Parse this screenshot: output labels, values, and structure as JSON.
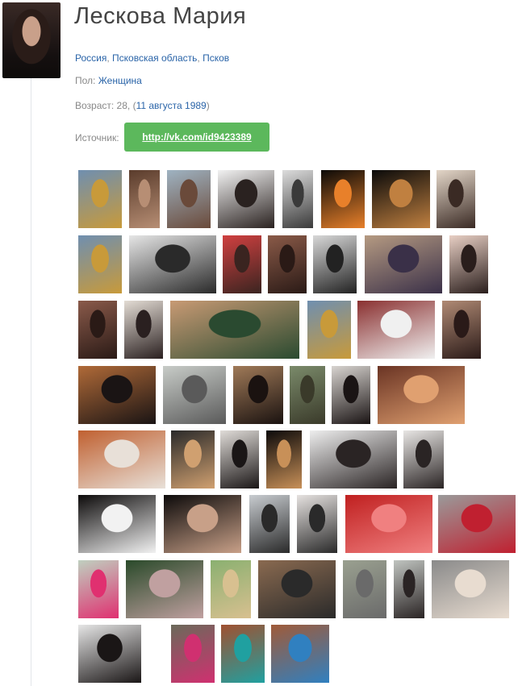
{
  "profile": {
    "name": "Лескова Мария",
    "location": {
      "country": "Россия",
      "region": "Псковская область",
      "city": "Псков",
      "separator": ", "
    },
    "gender": {
      "label": "Пол:",
      "value": "Женщина"
    },
    "age": {
      "label": "Возраст: 28, (",
      "date": "11 августа 1989",
      "suffix": ")"
    },
    "source": {
      "label": "Источник:",
      "link": "http://vk.com/id9423389",
      "button_color": "#5cb85c"
    }
  },
  "colors": {
    "link": "#2a64a8",
    "muted": "#888888",
    "title": "#444444"
  },
  "gallery": {
    "rows": [
      [
        {
          "c1": "#6f8fb0",
          "c2": "#c89a3a"
        },
        {
          "c1": "#5a3c2c",
          "c2": "#b78e74"
        },
        {
          "c1": "#9fb3c2",
          "c2": "#6a4a3a"
        },
        {
          "c1": "#f2f2f2",
          "c2": "#2a2220"
        },
        {
          "c1": "#dcdcdc",
          "c2": "#3a3a3a"
        },
        {
          "c1": "#0c0a08",
          "c2": "#e8802a"
        },
        {
          "c1": "#0a0a0a",
          "c2": "#c08040"
        },
        {
          "c1": "#e3d6c8",
          "c2": "#3a2a24"
        }
      ],
      [
        {
          "c1": "#6f8fb0",
          "c2": "#c89a3a"
        },
        {
          "c1": "#e6e6e6",
          "c2": "#2a2a2a"
        },
        {
          "c1": "#d04040",
          "c2": "#3a2420"
        },
        {
          "c1": "#8a5a48",
          "c2": "#2a1a16"
        },
        {
          "c1": "#d8d8d8",
          "c2": "#222222"
        },
        {
          "c1": "#b59a82",
          "c2": "#3a3048"
        },
        {
          "c1": "#e8cfc4",
          "c2": "#2a1e1c"
        }
      ],
      [
        {
          "c1": "#8a5a4a",
          "c2": "#2a1a16"
        },
        {
          "c1": "#e3dcd4",
          "c2": "#2a2020"
        },
        {
          "c1": "#c89a74",
          "c2": "#2a4a30"
        },
        {
          "c1": "#6f8fb0",
          "c2": "#c89a3a"
        },
        {
          "c1": "#8a3030",
          "c2": "#f0f0f0"
        },
        {
          "c1": "#b08a74",
          "c2": "#2a1a18"
        }
      ],
      [
        {
          "c1": "#b06a38",
          "c2": "#1a1414"
        },
        {
          "c1": "#c8ccc8",
          "c2": "#5a5a5a"
        },
        {
          "c1": "#a07a58",
          "c2": "#1a1210"
        },
        {
          "c1": "#7a8a6a",
          "c2": "#3a3a2a"
        },
        {
          "c1": "#d8d4d0",
          "c2": "#1a1414"
        },
        {
          "c1": "#6a3424",
          "c2": "#e0a070"
        }
      ],
      [
        {
          "c1": "#c06030",
          "c2": "#e8e0d8"
        },
        {
          "c1": "#2a2a2a",
          "c2": "#d0a070"
        },
        {
          "c1": "#e0dcd8",
          "c2": "#1a1616"
        },
        {
          "c1": "#0c0a0a",
          "c2": "#c89058"
        },
        {
          "c1": "#eeeeee",
          "c2": "#2a2424"
        },
        {
          "c1": "#e8e6e4",
          "c2": "#2a2424"
        }
      ],
      [
        {
          "c1": "#0c0a0a",
          "c2": "#f2f2f2"
        },
        {
          "c1": "#0c0a0a",
          "c2": "#c8a088"
        },
        {
          "c1": "#c8ccd0",
          "c2": "#2a2a2a"
        },
        {
          "c1": "#e6e2e0",
          "c2": "#2a2a2a"
        },
        {
          "c1": "#c02020",
          "c2": "#f08080"
        },
        {
          "c1": "#9a9a9a",
          "c2": "#c02030"
        }
      ],
      [
        {
          "c1": "#bfd0c0",
          "c2": "#e03070"
        },
        {
          "c1": "#2a4a2a",
          "c2": "#c0a0a0"
        },
        {
          "c1": "#8ab070",
          "c2": "#d8c090"
        },
        {
          "c1": "#8a6a50",
          "c2": "#2a2a2a"
        },
        {
          "c1": "#9aa090",
          "c2": "#6a6a6a"
        },
        {
          "c1": "#c0c4c0",
          "c2": "#2a2424"
        },
        {
          "c1": "#8a8a8a",
          "c2": "#e8dcd0"
        }
      ],
      [
        {
          "c1": "#e6e6e6",
          "c2": "#1a1616"
        },
        {
          "c1": "#6a6a5a",
          "c2": "#d03070"
        },
        {
          "c1": "#a05030",
          "c2": "#20a0a0"
        },
        {
          "c1": "#a05a38",
          "c2": "#3080c0"
        }
      ]
    ]
  }
}
